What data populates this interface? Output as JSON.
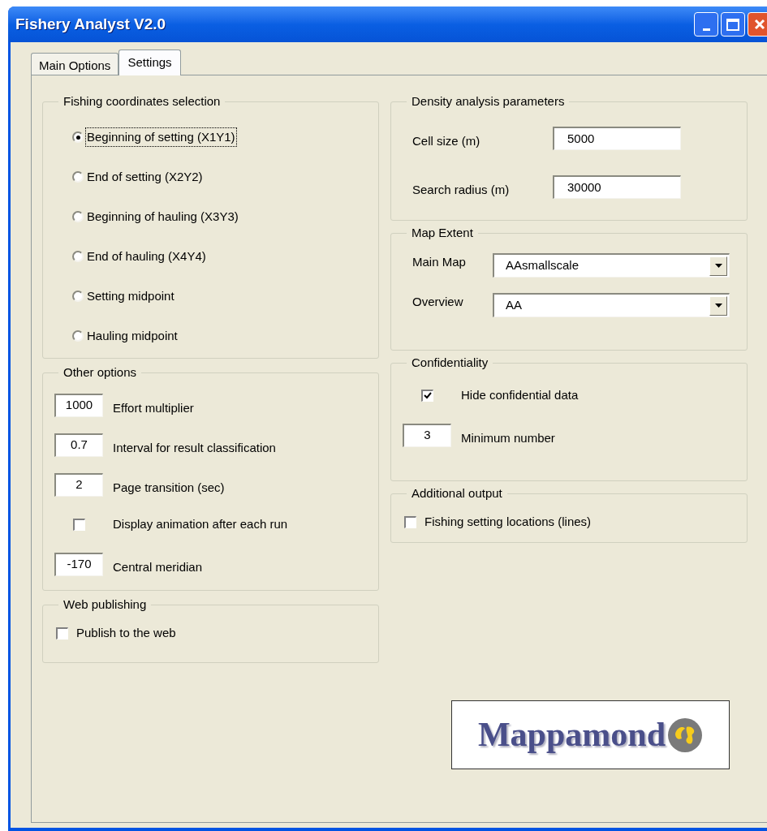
{
  "window": {
    "title": "Fishery Analyst V2.0"
  },
  "tabs": [
    {
      "label": "Main Options",
      "selected": false
    },
    {
      "label": "Settings",
      "selected": true
    }
  ],
  "left_groups": [
    {
      "title": "Fishing coordinates selection",
      "items": [
        {
          "kind": "radio",
          "label": "Beginning of setting (X1Y1)",
          "selected": true,
          "focused": true
        },
        {
          "kind": "radio",
          "label": "End of setting (X2Y2)",
          "selected": false,
          "focused": false
        },
        {
          "kind": "radio",
          "label": "Beginning of hauling (X3Y3)",
          "selected": false,
          "focused": false
        },
        {
          "kind": "radio",
          "label": "End of hauling (X4Y4)",
          "selected": false,
          "focused": false
        },
        {
          "kind": "radio",
          "label": "Setting midpoint",
          "selected": false,
          "focused": false
        },
        {
          "kind": "radio",
          "label": "Hauling midpoint",
          "selected": false,
          "focused": false
        }
      ]
    },
    {
      "title": "Other options",
      "items": [
        {
          "kind": "field",
          "value": "1000",
          "label": "Effort multiplier"
        },
        {
          "kind": "field",
          "value": "0.7",
          "label": "Interval for result classification"
        },
        {
          "kind": "field",
          "value": "2",
          "label": "Page transition (sec)"
        },
        {
          "kind": "checkbox_wide",
          "label": "Display animation after each run",
          "checked": false
        },
        {
          "kind": "field",
          "value": "-170",
          "label": "Central meridian"
        }
      ]
    },
    {
      "title": "Web publishing",
      "items": [
        {
          "kind": "checkbox",
          "label": "Publish to the web",
          "checked": false
        }
      ]
    }
  ],
  "right_groups": [
    {
      "title": "Density analysis parameters",
      "items": [
        {
          "kind": "labeled_field",
          "label": "Cell size (m)",
          "value": "5000"
        },
        {
          "kind": "labeled_field",
          "label": "Search radius (m)",
          "value": "30000"
        }
      ]
    },
    {
      "title": "Map Extent",
      "items": [
        {
          "kind": "dropdown",
          "label": "Main Map",
          "value": "AAsmallscale"
        },
        {
          "kind": "dropdown",
          "label": "Overview",
          "value": "AA"
        }
      ]
    },
    {
      "title": "Confidentiality",
      "items": [
        {
          "kind": "checkbox_wide",
          "label": "Hide confidential data",
          "checked": true
        },
        {
          "kind": "field",
          "value": "3",
          "label": "Minimum number"
        }
      ]
    },
    {
      "title": "Additional output",
      "items": [
        {
          "kind": "checkbox",
          "label": "Fishing setting locations (lines)",
          "checked": false
        }
      ]
    }
  ],
  "logo": {
    "text": "Mappamond"
  }
}
